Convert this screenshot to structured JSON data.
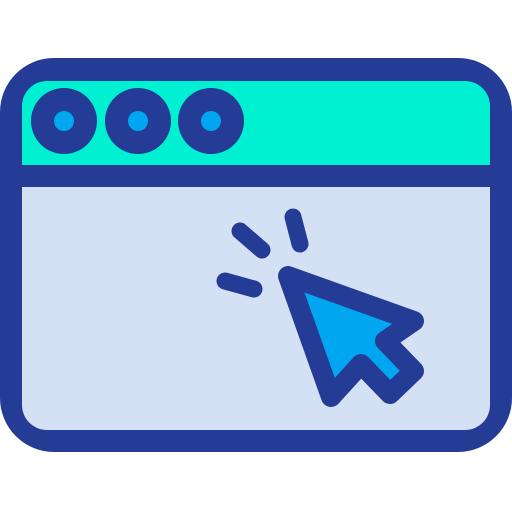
{
  "icon": {
    "name": "browser-window-click-icon",
    "colors": {
      "outline": "#243c96",
      "title_bar": "#00f0d2",
      "content": "#d4e1f4",
      "dot_fill": "#00a6f0",
      "cursor_fill": "#00a6f0",
      "background": "#ffffff"
    },
    "parts": [
      "window-frame",
      "title-bar",
      "window-dots",
      "content-area",
      "mouse-cursor",
      "click-rays"
    ]
  }
}
